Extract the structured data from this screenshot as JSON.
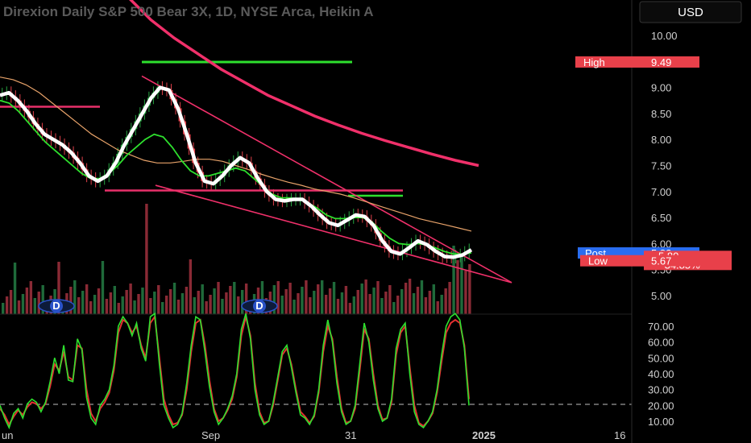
{
  "title": "Direxion Daily S&P 500 Bear 3X, 1D, NYSE Arca, Heikin A",
  "currency_button": "USD",
  "x_ticks": [
    "un",
    "Sep",
    "31",
    "2025",
    "16"
  ],
  "dividend_marker_label": "D",
  "badges": {
    "high_label": "High",
    "high_value": "9.49",
    "post_label": "Post",
    "post_value": "5.82",
    "last_value": "5.80",
    "last_change": "−34.85%",
    "low_label": "Low",
    "low_value": "5.67"
  },
  "colors": {
    "up": "#26a641",
    "down": "#e0404a",
    "white_line": "#ffffff",
    "green_ma": "#2ee02e",
    "orange_ma": "#e8a36a",
    "magenta": "#f0306a",
    "level_green": "#2ee02e",
    "level_pink": "#e8306a",
    "stoch_k": "#2ee02e",
    "stoch_d": "#e53030",
    "badge_red": "#e8404a",
    "badge_blue": "#2a6df0"
  },
  "chart_data": [
    {
      "type": "line",
      "title": "Direxion Daily S&P 500 Bear 3X, 1D, NYSE Arca, Heikin A",
      "y_ticks": [
        "10.00",
        "9.50",
        "9.00",
        "8.50",
        "8.00",
        "7.50",
        "7.00",
        "6.50",
        "6.00",
        "5.50",
        "5.00"
      ],
      "ylim": [
        4.8,
        10.45
      ],
      "x_ticks": [
        "un",
        "Sep",
        "31",
        "2025",
        "16"
      ],
      "series": [
        {
          "values": [
            8.85,
            8.9,
            8.75,
            8.55,
            8.3,
            8.1,
            8.0,
            7.9,
            7.75,
            7.55,
            7.3,
            7.2,
            7.3,
            7.55,
            7.9,
            8.2,
            8.5,
            8.8,
            9.0,
            8.95,
            8.6,
            8.1,
            7.55,
            7.2,
            7.15,
            7.3,
            7.5,
            7.65,
            7.55,
            7.25,
            7.0,
            6.85,
            6.82,
            6.85,
            6.85,
            6.72,
            6.55,
            6.4,
            6.35,
            6.45,
            6.55,
            6.52,
            6.35,
            6.05,
            5.85,
            5.8,
            5.92,
            6.05,
            5.98,
            5.85,
            5.75,
            5.74,
            5.78,
            5.88
          ]
        },
        {
          "values": [
            8.75,
            8.7,
            8.55,
            8.35,
            8.15,
            7.95,
            7.8,
            7.65,
            7.5,
            7.35,
            7.25,
            7.25,
            7.35,
            7.5,
            7.7,
            7.85,
            8.0,
            8.1,
            8.05,
            7.85,
            7.6,
            7.4,
            7.3,
            7.3,
            7.35,
            7.4,
            7.45,
            7.4,
            7.25,
            7.1,
            6.95,
            6.88,
            6.88,
            6.85,
            6.78,
            6.68,
            6.55,
            6.48,
            6.48,
            6.5,
            6.5,
            6.42,
            6.25,
            6.1,
            6.0,
            5.98,
            6.0,
            5.98,
            5.92,
            5.85,
            5.8,
            5.8,
            5.82
          ]
        },
        {
          "values": [
            9.2,
            9.15,
            9.05,
            8.9,
            8.7,
            8.5,
            8.3,
            8.1,
            7.95,
            7.8,
            7.7,
            7.6,
            7.55,
            7.55,
            7.58,
            7.62,
            7.62,
            7.58,
            7.5,
            7.42,
            7.33,
            7.25,
            7.18,
            7.12,
            7.05,
            7.0,
            6.95,
            6.88,
            6.8,
            6.72,
            6.64,
            6.56,
            6.48,
            6.42,
            6.36,
            6.3,
            6.24
          ]
        },
        {
          "values": [
            12.0,
            11.3,
            10.75,
            10.3,
            9.95,
            9.65,
            9.35,
            9.1,
            8.85,
            8.65,
            8.45,
            8.28,
            8.12,
            7.98,
            7.85,
            7.72,
            7.6,
            7.5
          ]
        }
      ],
      "levels": [
        {
          "y": 9.49,
          "x_range": [
            "Sep",
            "Sep"
          ]
        },
        {
          "y": 8.63
        },
        {
          "y": 7.02
        },
        {
          "y": 6.92
        }
      ],
      "badges": {
        "High": 9.49,
        "Post": 5.82,
        "Last": 5.8,
        "Change": "−34.85%",
        "Low": 5.67
      },
      "grid": false
    },
    {
      "type": "line",
      "y_ticks": [
        "70.00",
        "60.00",
        "50.00",
        "40.00",
        "30.00",
        "20.00",
        "10.00"
      ],
      "ylim": [
        6.5,
        78.0
      ],
      "reference_line": 20,
      "series": [
        {
          "values": [
            20,
            12,
            6,
            15,
            18,
            12,
            21,
            24,
            22,
            16,
            22,
            35,
            50,
            40,
            58,
            36,
            35,
            62,
            55,
            25,
            12,
            8,
            20,
            24,
            30,
            45,
            70,
            76,
            72,
            64,
            72,
            56,
            48,
            76,
            78,
            46,
            20,
            12,
            6,
            8,
            15,
            34,
            58,
            76,
            74,
            54,
            32,
            16,
            8,
            12,
            18,
            26,
            40,
            68,
            78,
            62,
            30,
            14,
            8,
            10,
            22,
            38,
            54,
            58,
            44,
            28,
            14,
            12,
            8,
            14,
            30,
            58,
            74,
            60,
            34,
            16,
            8,
            10,
            20,
            46,
            72,
            60,
            36,
            18,
            10,
            12,
            24,
            56,
            68,
            72,
            40,
            16,
            8,
            6,
            10,
            16,
            30,
            52,
            70,
            76,
            78,
            74,
            56,
            20
          ]
        },
        {
          "values": [
            18,
            14,
            8,
            13,
            17,
            14,
            19,
            22,
            21,
            18,
            21,
            32,
            46,
            42,
            54,
            38,
            36,
            58,
            56,
            30,
            15,
            10,
            18,
            22,
            28,
            42,
            66,
            74,
            72,
            66,
            70,
            58,
            50,
            72,
            76,
            50,
            24,
            14,
            8,
            9,
            14,
            30,
            54,
            72,
            74,
            58,
            36,
            18,
            10,
            12,
            17,
            24,
            38,
            64,
            76,
            64,
            34,
            16,
            9,
            10,
            20,
            36,
            52,
            56,
            46,
            30,
            16,
            13,
            9,
            13,
            28,
            54,
            70,
            62,
            38,
            18,
            9,
            10,
            18,
            42,
            68,
            62,
            40,
            20,
            11,
            12,
            22,
            52,
            66,
            70,
            44,
            20,
            9,
            7,
            10,
            15,
            28,
            48,
            66,
            72,
            74,
            72,
            58,
            24
          ]
        }
      ],
      "grid": false
    }
  ]
}
